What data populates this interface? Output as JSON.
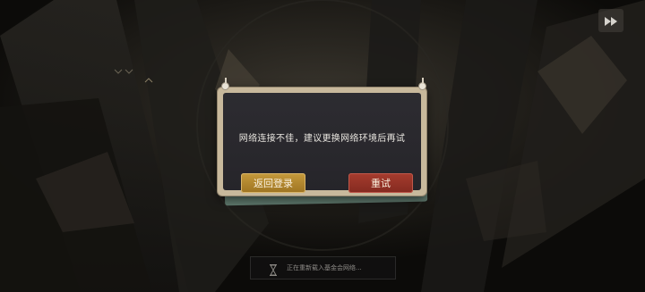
{
  "dialog": {
    "message": "网络连接不佳，建议更换网络环境后再试",
    "back_button": "返回登录",
    "retry_button": "重试"
  },
  "loading": {
    "text": "正在重新载入基金会网络...",
    "icon": "hourglass-icon"
  },
  "controls": {
    "skip_icon": "fast-forward-icon"
  },
  "colors": {
    "back_button": "#b78a30",
    "retry_button": "#952f24",
    "panel": "#2a292e",
    "frame": "#c8b99c"
  }
}
